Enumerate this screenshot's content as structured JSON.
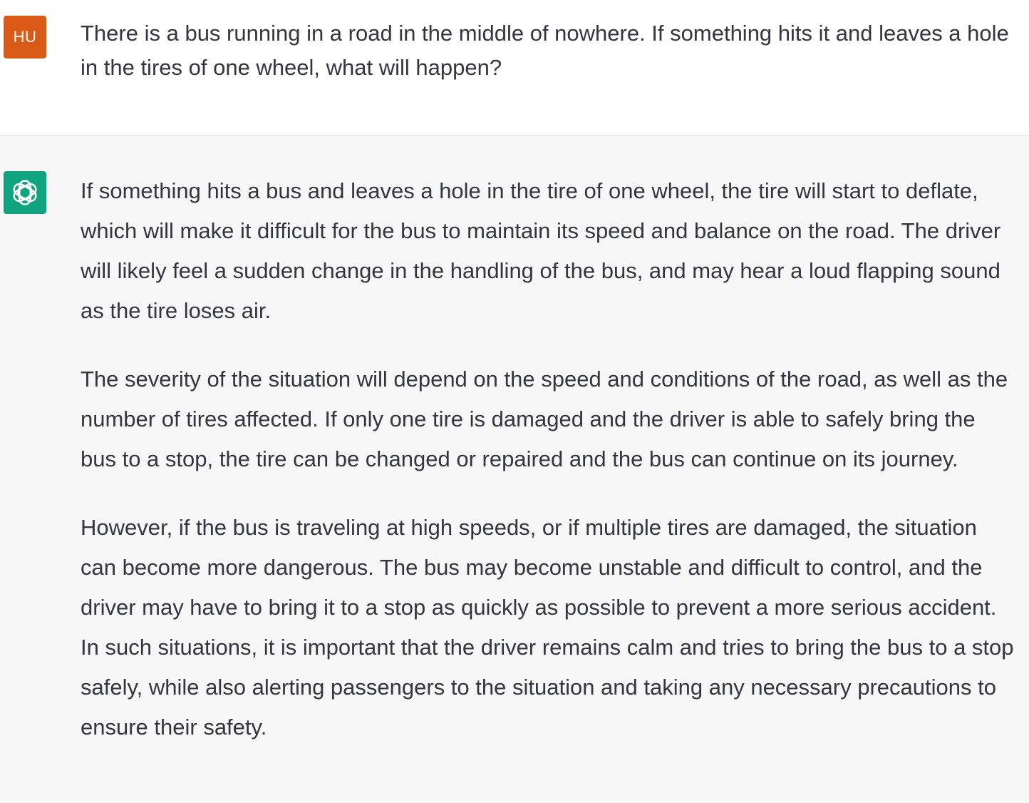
{
  "conversation": {
    "user": {
      "avatar_label": "HU",
      "message": "There is a bus running in a road in the middle of nowhere. If something hits it and leaves a hole in the tires of one wheel, what will happen?"
    },
    "assistant": {
      "avatar_icon": "openai-logo-icon",
      "paragraphs": [
        "If something hits a bus and leaves a hole in the tire of one wheel, the tire will start to deflate, which will make it difficult for the bus to maintain its speed and balance on the road. The driver will likely feel a sudden change in the handling of the bus, and may hear a loud flapping sound as the tire loses air.",
        "The severity of the situation will depend on the speed and conditions of the road, as well as the number of tires affected. If only one tire is damaged and the driver is able to safely bring the bus to a stop, the tire can be changed or repaired and the bus can continue on its journey.",
        "However, if the bus is traveling at high speeds, or if multiple tires are damaged, the situation can become more dangerous. The bus may become unstable and difficult to control, and the driver may have to bring it to a stop as quickly as possible to prevent a more serious accident. In such situations, it is important that the driver remains calm and tries to bring the bus to a stop safely, while also alerting passengers to the situation and taking any necessary precautions to ensure their safety."
      ]
    }
  },
  "colors": {
    "user_avatar_bg": "#d95a17",
    "assistant_avatar_bg": "#10a37f",
    "user_turn_bg": "#ffffff",
    "assistant_turn_bg": "#f7f7f8",
    "text": "#343541"
  }
}
